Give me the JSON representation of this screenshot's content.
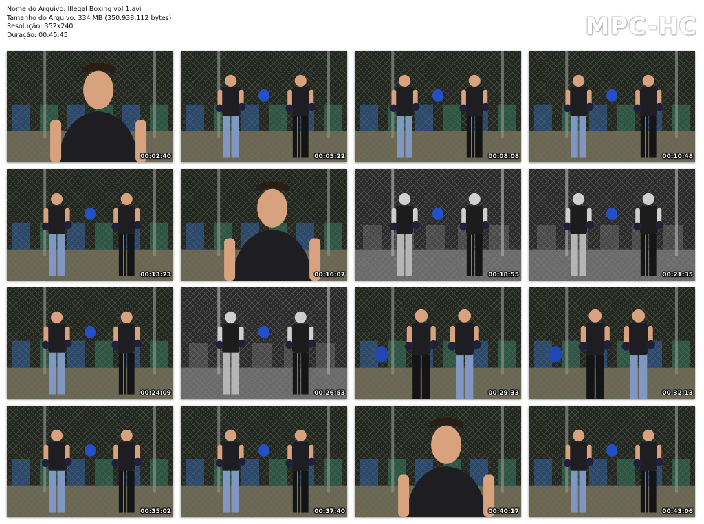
{
  "file_info": {
    "name_line": "Nome do Arquivo: Illegal Boxing vol 1.avi",
    "size_line": "Tamanho do Arquivo: 334 MB (350.938.112 bytes)",
    "resolution_line": "Resolução: 352x240",
    "duration_line": "Duração: 00:45:45"
  },
  "logo_text": "MPC-HC",
  "thumbnails": [
    {
      "timestamp": "00:02:40",
      "scene": "closeup",
      "palette": "color"
    },
    {
      "timestamp": "00:05:22",
      "scene": "two",
      "palette": "color"
    },
    {
      "timestamp": "00:08:08",
      "scene": "two",
      "palette": "color"
    },
    {
      "timestamp": "00:10:48",
      "scene": "two",
      "palette": "color"
    },
    {
      "timestamp": "00:13:23",
      "scene": "two",
      "palette": "color"
    },
    {
      "timestamp": "00:16:07",
      "scene": "closeup",
      "palette": "color"
    },
    {
      "timestamp": "00:18:55",
      "scene": "two",
      "palette": "bw"
    },
    {
      "timestamp": "00:21:35",
      "scene": "two",
      "palette": "bw"
    },
    {
      "timestamp": "00:24:09",
      "scene": "two",
      "palette": "color"
    },
    {
      "timestamp": "00:26:53",
      "scene": "two",
      "palette": "bw"
    },
    {
      "timestamp": "00:29:33",
      "scene": "clinch",
      "palette": "color"
    },
    {
      "timestamp": "00:32:13",
      "scene": "clinch",
      "palette": "color"
    },
    {
      "timestamp": "00:35:02",
      "scene": "two",
      "palette": "color"
    },
    {
      "timestamp": "00:37:40",
      "scene": "two",
      "palette": "color"
    },
    {
      "timestamp": "00:40:17",
      "scene": "closeup",
      "palette": "color"
    },
    {
      "timestamp": "00:43:06",
      "scene": "two",
      "palette": "color"
    }
  ]
}
